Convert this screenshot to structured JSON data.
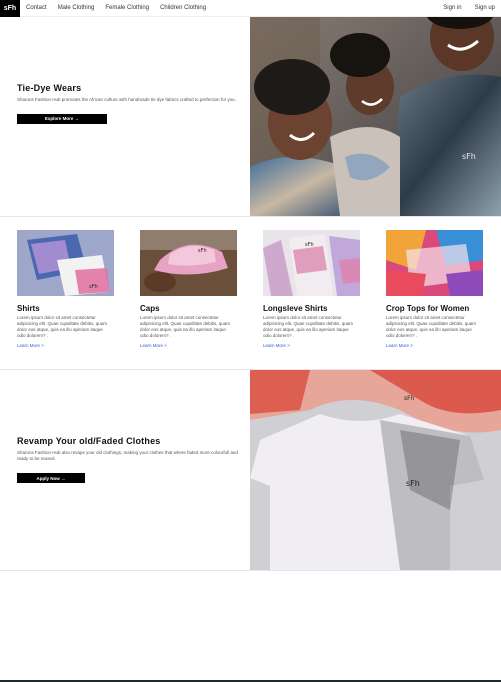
{
  "nav": {
    "brand": "sFh",
    "links": [
      "Contact",
      "Male Clothing",
      "Female Clothing",
      "Children Clothing"
    ],
    "signin": "Sign in",
    "signup": "Sign up"
  },
  "hero": {
    "title": "Tie-Dye Wears",
    "description": "Sharons Fashion Hub promotes the African culture with handmade tie dye fabrics crafted to perfection for you.",
    "button": "Explore More →"
  },
  "categories": [
    {
      "title": "Shirts",
      "text": "Lorem ipsum dolor sit amet consectetur adipisicing elit. Quae cupiditate debitis, quam dolor eos atque, quis ea illo aperiam itaque odio dolorem? .",
      "link": "Learn More >"
    },
    {
      "title": "Caps",
      "text": "Lorem ipsum dolor sit amet consectetur adipisicing elit. Quae cupiditate debitis, quam dolor eos atque, quis ea illo aperiam itaque odio dolorem? .",
      "link": "Learn More >"
    },
    {
      "title": "Longsleve Shirts",
      "text": "Lorem ipsum dolor sit amet consectetur adipisicing elit. Quae cupiditate debitis, quam dolor eos atque, quis ea illo aperiam itaque odio dolorem? .",
      "link": "Learn More >"
    },
    {
      "title": "Crop Tops for Women",
      "text": "Lorem ipsum dolor sit amet consectetur adipisicing elit. Quae cupiditate debitis, quam dolor eos atque, quis ea illo aperiam itaque odio dolorem? .",
      "link": "Learn More >"
    }
  ],
  "revamp": {
    "title": "Revamp Your old/Faded Clothes",
    "description": "Sharons Fashion Hub also revaps your old clothings, making your clothes that where faded more colourfull and ready to be reused.",
    "button": "Apply Now →"
  },
  "colors": {
    "accent_link": "#2a5bd7",
    "button_bg": "#000000"
  }
}
